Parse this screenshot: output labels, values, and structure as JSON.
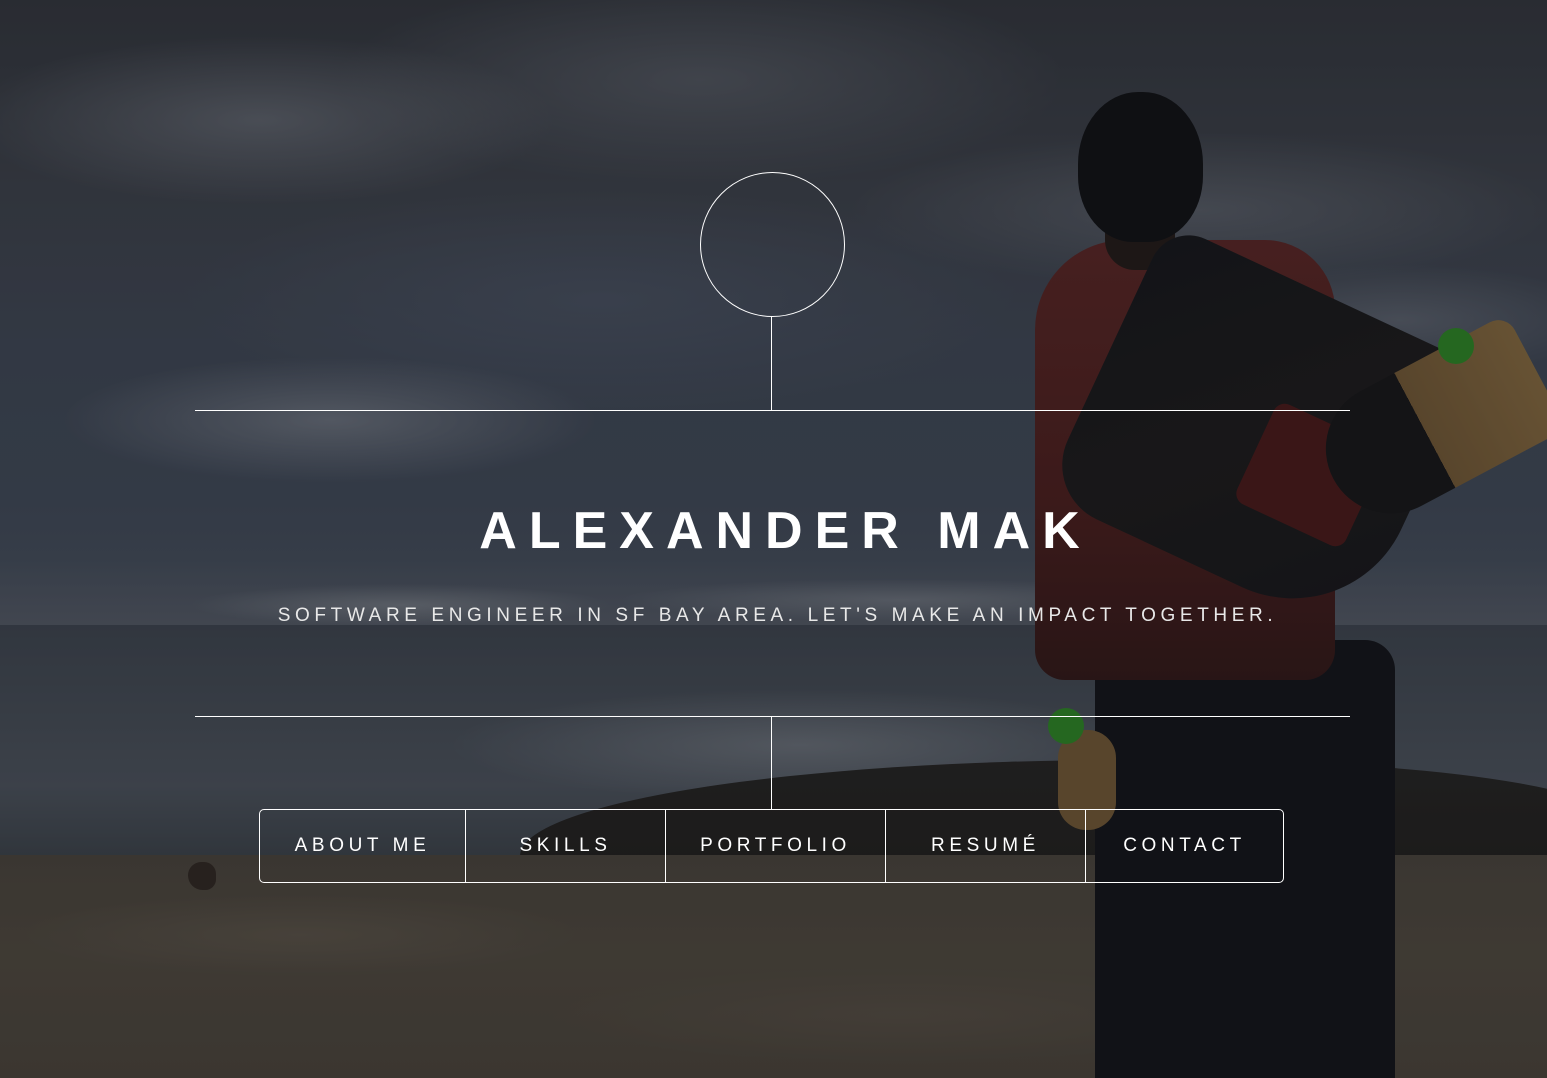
{
  "hero": {
    "name": "ALEXANDER MAK",
    "tagline": "SOFTWARE ENGINEER IN SF BAY AREA. LET'S MAKE AN IMPACT TOGETHER.",
    "background": "beach-landscape-photo"
  },
  "nav": {
    "items": [
      {
        "label": "ABOUT ME"
      },
      {
        "label": "SKILLS"
      },
      {
        "label": "PORTFOLIO"
      },
      {
        "label": "RESUMÉ"
      },
      {
        "label": "CONTACT"
      }
    ]
  },
  "colors": {
    "foreground": "#ffffff",
    "overlay": "#0a0c12"
  }
}
